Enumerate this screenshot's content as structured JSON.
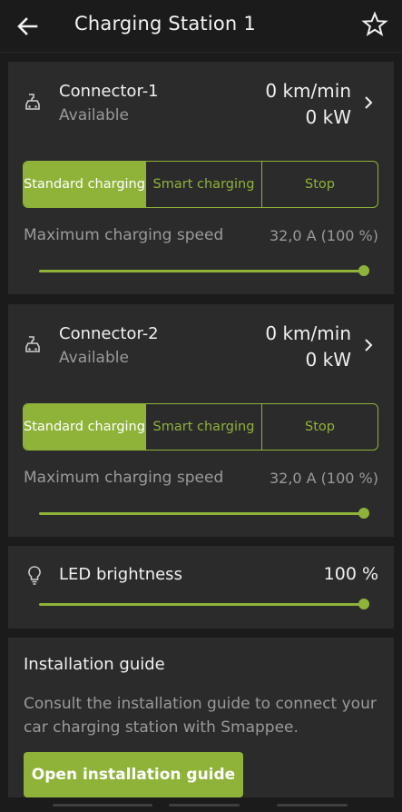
{
  "header": {
    "title": "Charging Station 1"
  },
  "connectors": [
    {
      "name": "Connector-1",
      "status": "Available",
      "speed": "0 km/min",
      "power": "0 kW",
      "modes": [
        "Standard charging",
        "Smart charging",
        "Stop"
      ],
      "active_mode_index": 0,
      "max_speed_label": "Maximum charging speed",
      "max_speed_value": "32,0 A (100 %)",
      "max_speed_percent": 100
    },
    {
      "name": "Connector-2",
      "status": "Available",
      "speed": "0 km/min",
      "power": "0 kW",
      "modes": [
        "Standard charging",
        "Smart charging",
        "Stop"
      ],
      "active_mode_index": 0,
      "max_speed_label": "Maximum charging speed",
      "max_speed_value": "32,0 A (100 %)",
      "max_speed_percent": 100
    }
  ],
  "led": {
    "label": "LED brightness",
    "value": "100 %",
    "percent": 100
  },
  "guide": {
    "title": "Installation guide",
    "text": "Consult the installation guide to connect your car charging station with Smappee.",
    "button_label": "Open installation guide"
  },
  "colors": {
    "accent": "#8fb339",
    "background": "#1b1b1b",
    "card": "#2b2b2b"
  },
  "icons": {
    "back": "arrow-left-icon",
    "favorite": "star-outline-icon",
    "connector": "ev-charger-car-icon",
    "chevron": "chevron-right-icon",
    "led": "lightbulb-icon"
  }
}
